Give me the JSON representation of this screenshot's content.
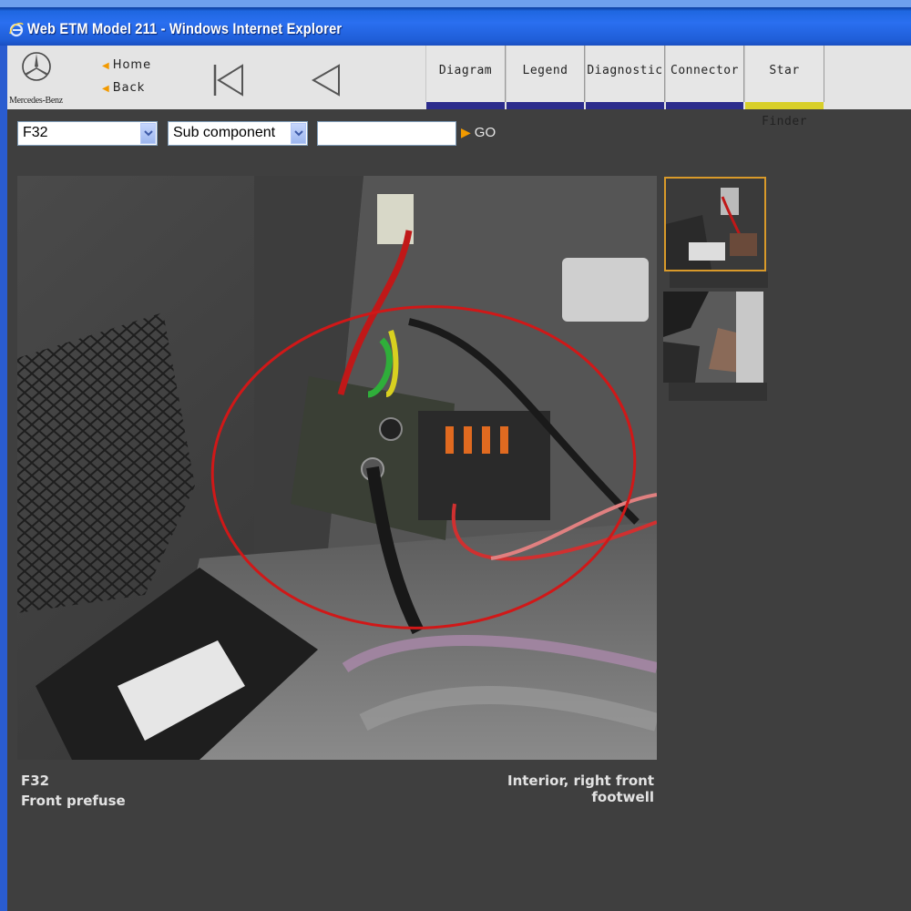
{
  "window": {
    "title": "Web ETM Model 211 - Windows Internet Explorer",
    "icon": "ie-icon"
  },
  "header": {
    "logo_text": "Mercedes-Benz",
    "logo_icon": "mercedes-star-icon",
    "nav": {
      "home_label": "Home",
      "back_label": "Back",
      "first_icon": "first-page-icon",
      "prev_icon": "previous-icon"
    },
    "tabs": [
      {
        "label": "Diagram",
        "active": false
      },
      {
        "label": "Legend",
        "active": false
      },
      {
        "label": "Diagnostic",
        "active": false
      },
      {
        "label": "Connector",
        "active": false
      },
      {
        "label": "Star Finder",
        "active": true
      }
    ],
    "colors": {
      "tab_strip": "#2c2c8c",
      "tab_strip_active": "#d8cf2a",
      "accent_arrow": "#f29a00"
    }
  },
  "search": {
    "component_value": "F32",
    "subcomponent_value": "Sub component",
    "input_value": "",
    "go_label": "GO"
  },
  "content": {
    "component_code": "F32",
    "component_name": "Front prefuse",
    "location": "Interior, right front footwell",
    "highlight_color": "#d01818"
  },
  "thumbnails": [
    {
      "selected": true
    },
    {
      "selected": false
    }
  ]
}
